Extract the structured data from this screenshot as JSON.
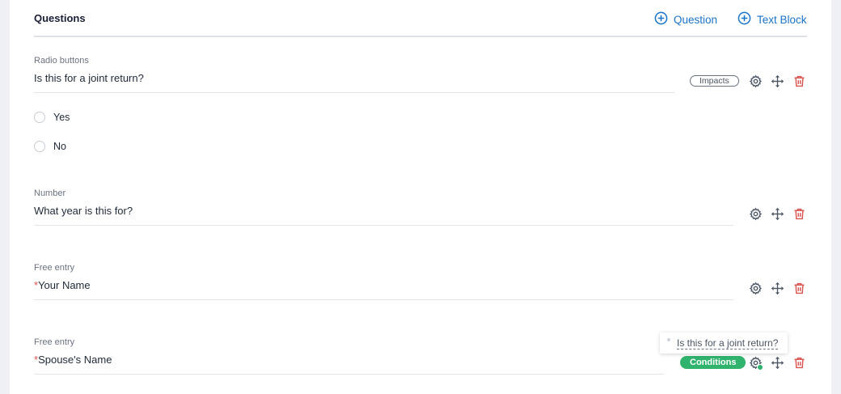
{
  "header": {
    "title": "Questions",
    "add_question_label": "Question",
    "add_text_block_label": "Text Block"
  },
  "questions": [
    {
      "type": "Radio buttons",
      "text": "Is this for a joint return?",
      "required": false,
      "badge": "Impacts",
      "options": [
        "Yes",
        "No"
      ]
    },
    {
      "type": "Number",
      "text": "What year is this for?",
      "required": false
    },
    {
      "type": "Free entry",
      "text": "Your Name",
      "required": true,
      "required_marker": "*"
    },
    {
      "type": "Free entry",
      "text": "Spouse's Name",
      "required": true,
      "required_marker": "*",
      "badge": "Conditions",
      "tooltip": "Is this for a joint return?"
    }
  ],
  "colors": {
    "accent": "#1a73c8",
    "delete": "#d9534f",
    "conditions": "#2fb36d",
    "icon": "#4b5563"
  },
  "icons": {
    "add": "plus-circle-icon",
    "settings": "gear-icon",
    "move": "move-arrows-icon",
    "delete": "trash-icon"
  }
}
